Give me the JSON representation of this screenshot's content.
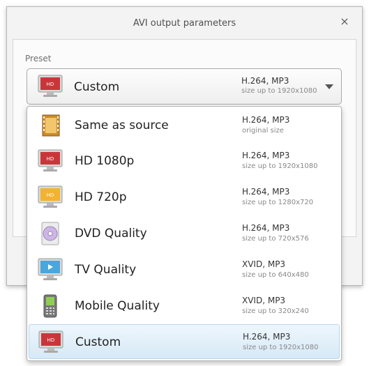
{
  "dialog": {
    "title": "AVI output parameters",
    "close_symbol": "×",
    "preset_label": "Preset"
  },
  "combo": {
    "name": "Custom",
    "codec": "H.264, MP3",
    "size": "size up to 1920x1080",
    "icon": "hd-red-monitor-icon"
  },
  "options": [
    {
      "name": "Same as source",
      "codec": "H.264, MP3",
      "size": "original size",
      "icon": "film-strip-icon"
    },
    {
      "name": "HD 1080p",
      "codec": "H.264, MP3",
      "size": "size up to 1920x1080",
      "icon": "hd-red-monitor-icon"
    },
    {
      "name": "HD 720p",
      "codec": "H.264, MP3",
      "size": "size up to 1280x720",
      "icon": "hd-yellow-monitor-icon"
    },
    {
      "name": "DVD Quality",
      "codec": "H.264, MP3",
      "size": "size up to 720x576",
      "icon": "dvd-icon"
    },
    {
      "name": "TV Quality",
      "codec": "XVID, MP3",
      "size": "size up to 640x480",
      "icon": "tv-icon"
    },
    {
      "name": "Mobile Quality",
      "codec": "XVID, MP3",
      "size": "size up to 320x240",
      "icon": "mobile-phone-icon"
    },
    {
      "name": "Custom",
      "codec": "H.264, MP3",
      "size": "size up to 1920x1080",
      "icon": "hd-red-monitor-icon",
      "selected": true
    }
  ],
  "icon_text": {
    "hd": "HD"
  }
}
